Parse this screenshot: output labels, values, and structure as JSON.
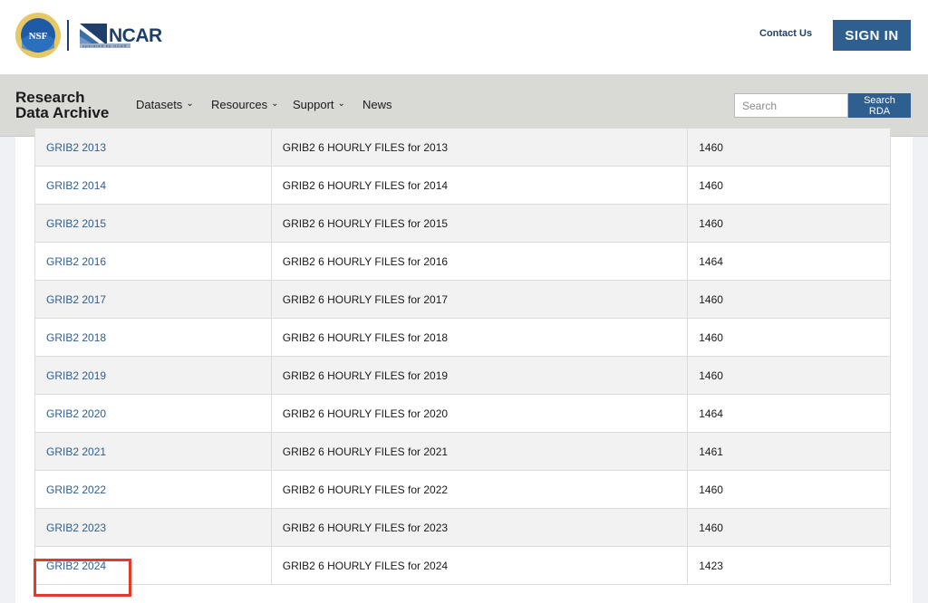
{
  "header": {
    "nsf_logo_text": "NSF",
    "ncar_logo_text": "NCAR",
    "ncar_logo_subtext": "operated by UCAR",
    "contact_label": "Contact Us",
    "signin_label": "SIGN IN"
  },
  "nav": {
    "brand_line1": "Research",
    "brand_line2": "Data Archive",
    "items": [
      {
        "label": "Datasets",
        "has_dropdown": true
      },
      {
        "label": "Resources",
        "has_dropdown": true
      },
      {
        "label": "Support",
        "has_dropdown": true
      },
      {
        "label": "News",
        "has_dropdown": false
      }
    ],
    "search_placeholder": "Search",
    "search_button": "Search RDA"
  },
  "colors": {
    "brand_blue": "#2f5f8e",
    "nav_bg": "#d9dad6",
    "highlight": "#e53a2b"
  },
  "table": {
    "rows": [
      {
        "name": "GRIB2 2013",
        "description": "GRIB2 6 HOURLY FILES for 2013",
        "count": "1460"
      },
      {
        "name": "GRIB2 2014",
        "description": "GRIB2 6 HOURLY FILES for 2014",
        "count": "1460"
      },
      {
        "name": "GRIB2 2015",
        "description": "GRIB2 6 HOURLY FILES for 2015",
        "count": "1460"
      },
      {
        "name": "GRIB2 2016",
        "description": "GRIB2 6 HOURLY FILES for 2016",
        "count": "1464"
      },
      {
        "name": "GRIB2 2017",
        "description": "GRIB2 6 HOURLY FILES for 2017",
        "count": "1460"
      },
      {
        "name": "GRIB2 2018",
        "description": "GRIB2 6 HOURLY FILES for 2018",
        "count": "1460"
      },
      {
        "name": "GRIB2 2019",
        "description": "GRIB2 6 HOURLY FILES for 2019",
        "count": "1460"
      },
      {
        "name": "GRIB2 2020",
        "description": "GRIB2 6 HOURLY FILES for 2020",
        "count": "1464"
      },
      {
        "name": "GRIB2 2021",
        "description": "GRIB2 6 HOURLY FILES for 2021",
        "count": "1461"
      },
      {
        "name": "GRIB2 2022",
        "description": "GRIB2 6 HOURLY FILES for 2022",
        "count": "1460"
      },
      {
        "name": "GRIB2 2023",
        "description": "GRIB2 6 HOURLY FILES for 2023",
        "count": "1460"
      },
      {
        "name": "GRIB2 2024",
        "description": "GRIB2 6 HOURLY FILES for 2024",
        "count": "1423"
      }
    ],
    "highlighted_row": "GRIB2 2024"
  }
}
